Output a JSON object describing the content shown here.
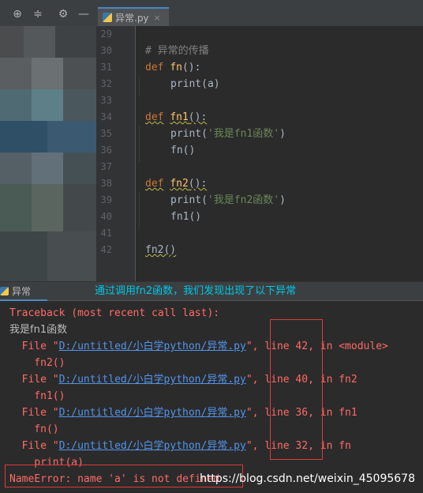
{
  "toolbar": {
    "icons": [
      "target-icon",
      "collapse-icon",
      "gear-icon",
      "hide-icon"
    ]
  },
  "editor_tab": {
    "label": "异常.py",
    "close": "×"
  },
  "gutter_lines": [
    "29",
    "30",
    "31",
    "32",
    "33",
    "34",
    "35",
    "36",
    "37",
    "38",
    "39",
    "40",
    "41",
    "42"
  ],
  "code": {
    "comment": "# 异常的传播",
    "def_kw": "def",
    "fn_name": "fn",
    "fn1_name": "fn1",
    "fn2_name": "fn2",
    "paren_colon": "():",
    "print_a": "print(a)",
    "print_fn1_pre": "print(",
    "print_fn1_str": "'我是fn1函数'",
    "print_post": ")",
    "call_fn": "fn()",
    "print_fn2_pre": "print(",
    "print_fn2_str": "'我是fn2函数'",
    "call_fn1": "fn1()",
    "call_fn2": "fn2()"
  },
  "run_panel": {
    "tab_label": "异常",
    "annotation": "通过调用fn2函数，我们发现出现了以下异常"
  },
  "console": {
    "traceback": "Traceback (most recent call last):",
    "stdout": "我是fn1函数",
    "frames": [
      {
        "prefix": "  File \"",
        "path": "D:/untitled/小白学python/异常.py",
        "mid": "\", ",
        "line": "line 42,",
        "where": " in <module>",
        "code": "    fn2()"
      },
      {
        "prefix": "  File \"",
        "path": "D:/untitled/小白学python/异常.py",
        "mid": "\", ",
        "line": "line 40,",
        "where": " in fn2",
        "code": "    fn1()"
      },
      {
        "prefix": "  File \"",
        "path": "D:/untitled/小白学python/异常.py",
        "mid": "\", ",
        "line": "line 36,",
        "where": " in fn1",
        "code": "    fn()"
      },
      {
        "prefix": "  File \"",
        "path": "D:/untitled/小白学python/异常.py",
        "mid": "\", ",
        "line": "line 32,",
        "where": " in fn",
        "code": "    print(a)"
      }
    ],
    "error": "NameError: name 'a' is not defined"
  },
  "watermark": "https://blog.csdn.net/weixin_45095678",
  "colors": {
    "keyword": "#cc7832",
    "function": "#ffc66d",
    "string": "#6a8759",
    "error": "#ff6b68",
    "link": "#5394ec",
    "annotation": "#00c8e6",
    "highlight_box": "#e03a3a"
  }
}
